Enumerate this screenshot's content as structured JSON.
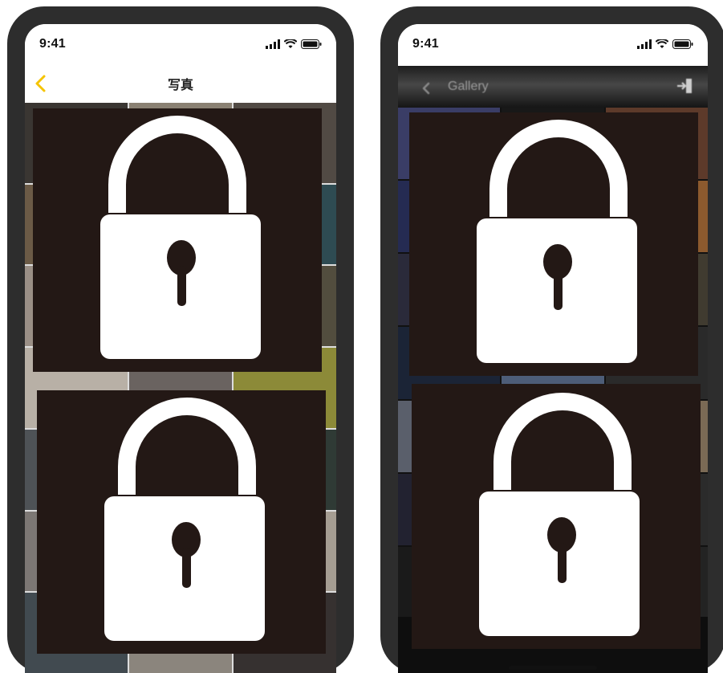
{
  "left_phone": {
    "status": {
      "time": "9:41"
    },
    "nav": {
      "title": "写真"
    },
    "accent_color": "#f5c400",
    "photo_colors": [
      "#3a3632",
      "#8a8173",
      "#514a44",
      "#6b5a46",
      "#c9c3ba",
      "#2e4b52",
      "#9a8f86",
      "#3c3530",
      "#524d3e",
      "#b8b0a6",
      "#6a6360",
      "#8c8a38",
      "#4e5256",
      "#d7d3ce",
      "#2f3a35",
      "#7c7774",
      "#5a5350",
      "#a59d92",
      "#414a50",
      "#8b857d",
      "#363130"
    ]
  },
  "right_phone": {
    "status": {
      "time": "9:41"
    },
    "nav": {
      "title": "Gallery"
    },
    "photo_colors": [
      "#3a3d66",
      "#181818",
      "#5d3a2a",
      "#252b52",
      "#1e1e1e",
      "#8c5a2e",
      "#2a2a3a",
      "#6b5a44",
      "#403b30",
      "#1b2436",
      "#4d5d78",
      "#2a2a2a",
      "#5a5f6b",
      "#3a3a3a",
      "#7b6a55",
      "#222230",
      "#8d8b86",
      "#2b2b2b",
      "#1a1a1a",
      "#3b3b45",
      "#232323"
    ]
  },
  "icons": {
    "lock": "lock-icon",
    "back": "chevron-left-icon",
    "signal": "signal-icon",
    "wifi": "wifi-icon",
    "battery": "battery-icon",
    "exit": "exit-icon"
  },
  "lock_overlay_color": "#231815"
}
